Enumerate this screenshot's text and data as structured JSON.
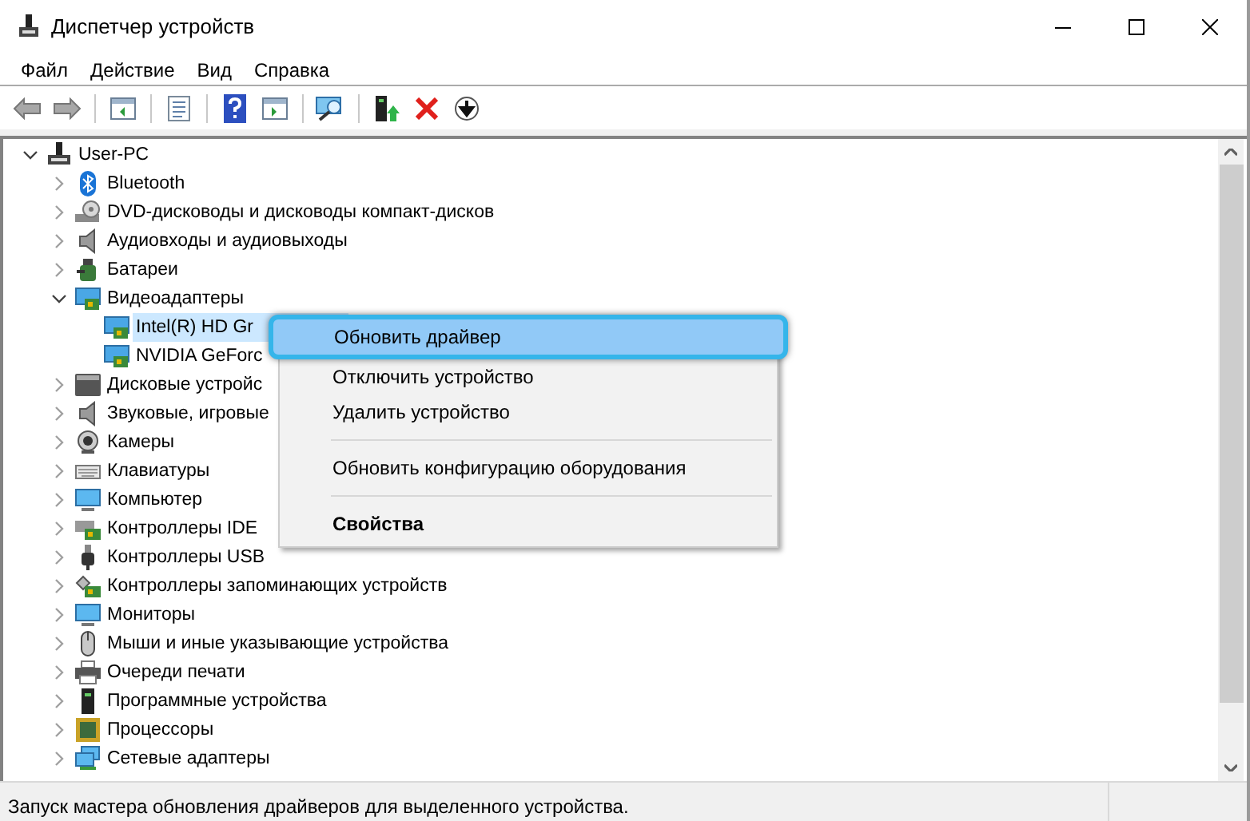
{
  "window": {
    "title": "Диспетчер устройств"
  },
  "menu": [
    {
      "label": "Файл"
    },
    {
      "label": "Действие"
    },
    {
      "label": "Вид"
    },
    {
      "label": "Справка"
    }
  ],
  "toolbar": [
    {
      "kind": "back",
      "disabled": true
    },
    {
      "kind": "forward",
      "disabled": true
    },
    {
      "kind": "pane"
    },
    {
      "kind": "properties"
    },
    {
      "kind": "help"
    },
    {
      "kind": "action-pane"
    },
    {
      "kind": "scan"
    },
    {
      "kind": "update"
    },
    {
      "kind": "uninstall"
    },
    {
      "kind": "disable"
    }
  ],
  "tree": {
    "label": "User-PC",
    "expanded": true,
    "selected": false,
    "children": [
      {
        "label": "Bluetooth",
        "expanded": false,
        "selected": false
      },
      {
        "label": "DVD-дисководы и дисководы компакт-дисков",
        "expanded": false,
        "selected": false
      },
      {
        "label": "Аудиовходы и аудиовыходы",
        "expanded": false,
        "selected": false
      },
      {
        "label": "Батареи",
        "expanded": false,
        "selected": false
      },
      {
        "label": "Видеоадаптеры",
        "expanded": true,
        "selected": false,
        "children": [
          {
            "label": "Intel(R) HD Gr",
            "selected": true
          },
          {
            "label": "NVIDIA GeForc",
            "selected": false
          }
        ]
      },
      {
        "label": "Дисковые устройс",
        "expanded": false,
        "selected": false
      },
      {
        "label": "Звуковые, игровые",
        "expanded": false,
        "selected": false
      },
      {
        "label": "Камеры",
        "expanded": false,
        "selected": false
      },
      {
        "label": "Клавиатуры",
        "expanded": false,
        "selected": false
      },
      {
        "label": "Компьютер",
        "expanded": false,
        "selected": false
      },
      {
        "label": "Контроллеры IDE",
        "expanded": false,
        "selected": false
      },
      {
        "label": "Контроллеры USB",
        "expanded": false,
        "selected": false
      },
      {
        "label": "Контроллеры запоминающих устройств",
        "expanded": false,
        "selected": false
      },
      {
        "label": "Мониторы",
        "expanded": false,
        "selected": false
      },
      {
        "label": "Мыши и иные указывающие устройства",
        "expanded": false,
        "selected": false
      },
      {
        "label": "Очереди печати",
        "expanded": false,
        "selected": false
      },
      {
        "label": "Программные устройства",
        "expanded": false,
        "selected": false
      },
      {
        "label": "Процессоры",
        "expanded": false,
        "selected": false
      },
      {
        "label": "Сетевые адаптеры",
        "expanded": false,
        "selected": false
      }
    ]
  },
  "context_menu": {
    "items": [
      {
        "kind": "item",
        "label": "Обновить драйвер",
        "highlighted": true,
        "default": false
      },
      {
        "kind": "item",
        "label": "Отключить устройство",
        "highlighted": false,
        "default": false
      },
      {
        "kind": "item",
        "label": "Удалить устройство",
        "highlighted": false,
        "default": false
      },
      {
        "kind": "separator"
      },
      {
        "kind": "item",
        "label": "Обновить конфигурацию оборудования",
        "highlighted": false,
        "default": false
      },
      {
        "kind": "separator"
      },
      {
        "kind": "item",
        "label": "Свойства",
        "highlighted": false,
        "default": true
      }
    ]
  },
  "status_bar": {
    "text": "Запуск мастера обновления драйверов для выделенного устройства."
  }
}
